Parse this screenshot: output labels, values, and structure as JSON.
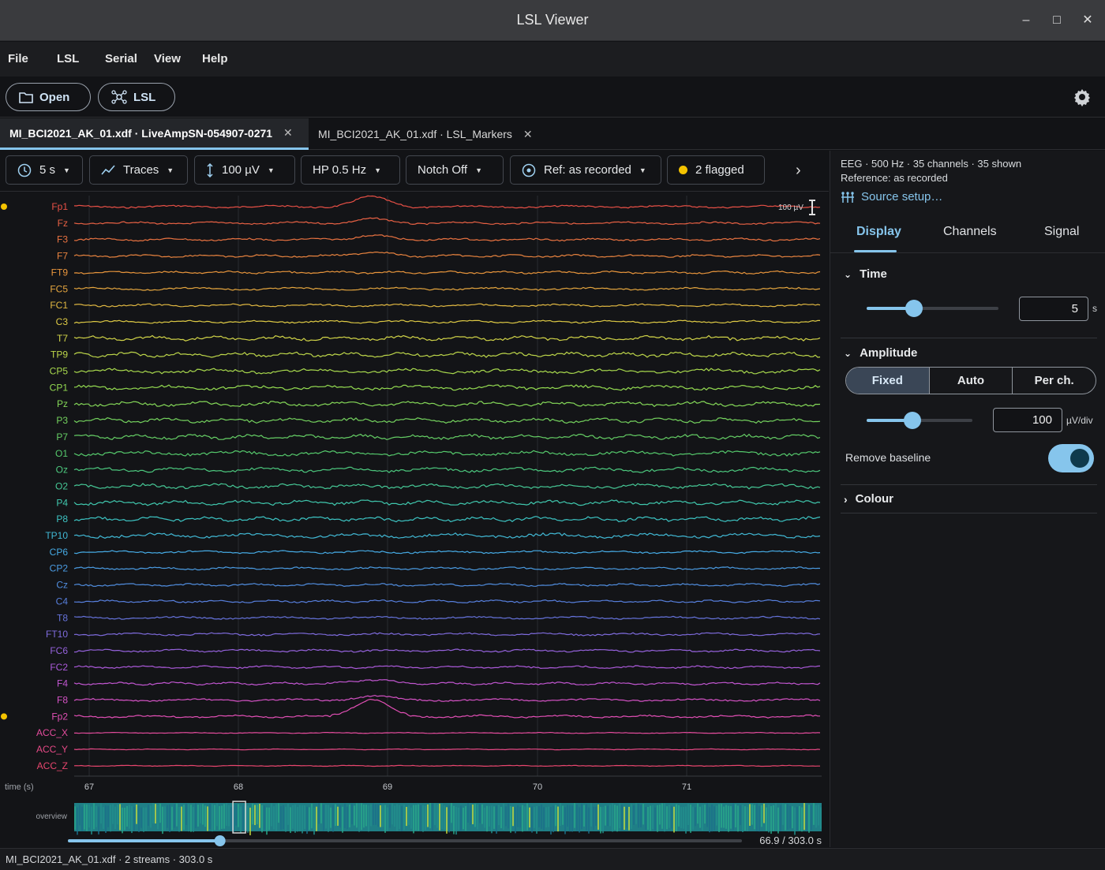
{
  "window": {
    "title": "LSL Viewer"
  },
  "menu": [
    "File",
    "LSL",
    "Serial",
    "View",
    "Help"
  ],
  "toolbar": {
    "open_label": "Open",
    "lsl_label": "LSL"
  },
  "tabs": [
    {
      "label": "MI_BCI2021_AK_01.xdf · LiveAmpSN-054907-0271",
      "active": true
    },
    {
      "label": "MI_BCI2021_AK_01.xdf · LSL_Markers",
      "active": false
    }
  ],
  "controls": {
    "window_label": "5 s",
    "mode_label": "Traces",
    "amplitude_label": "100 µV",
    "highpass_label": "HP 0.5 Hz",
    "notch_label": "Notch Off",
    "ref_label": "Ref: as recorded",
    "flagged_label": "2 flagged"
  },
  "channels": [
    "Fp1",
    "Fz",
    "F3",
    "F7",
    "FT9",
    "FC5",
    "FC1",
    "C3",
    "T7",
    "TP9",
    "CP5",
    "CP1",
    "Pz",
    "P3",
    "P7",
    "O1",
    "Oz",
    "O2",
    "P4",
    "P8",
    "TP10",
    "CP6",
    "CP2",
    "Cz",
    "C4",
    "T8",
    "FT10",
    "FC6",
    "FC2",
    "F4",
    "F8",
    "Fp2",
    "ACC_X",
    "ACC_Y",
    "ACC_Z"
  ],
  "flagged_channels": [
    "Fp1",
    "Fp2"
  ],
  "plot": {
    "scale_label": "100 µV",
    "time_axis_label": "time (s)",
    "time_ticks": [
      "67",
      "68",
      "69",
      "70",
      "71"
    ],
    "overview_label": "overview",
    "position_label": "66.9 / 303.0 s",
    "position_value": 66.9,
    "duration_value": 303.0
  },
  "side": {
    "info_line1": "EEG · 500 Hz · 35 channels · 35 shown",
    "info_line2": "Reference: as recorded",
    "source_setup": "Source setup…",
    "tabs": [
      "Display",
      "Channels",
      "Signal"
    ],
    "time_section": "Time",
    "time_value": "5",
    "time_unit": "s",
    "amplitude_section": "Amplitude",
    "amp_modes": [
      "Fixed",
      "Auto",
      "Per ch."
    ],
    "amp_value": "100",
    "amp_unit": "µV/div",
    "remove_baseline": "Remove baseline",
    "colour_section": "Colour"
  },
  "status": "MI_BCI2021_AK_01.xdf · 2 streams · 303.0 s"
}
